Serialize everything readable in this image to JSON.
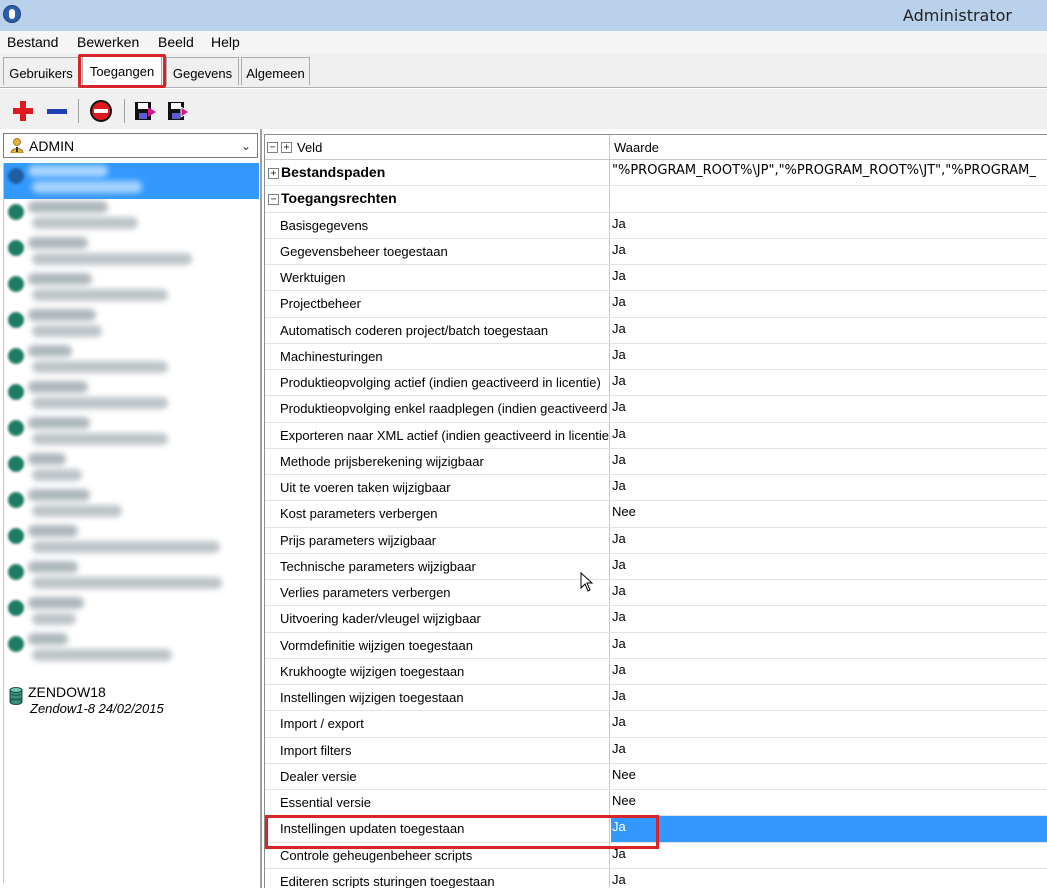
{
  "window": {
    "title": "Administrator"
  },
  "menu": [
    {
      "label": "Bestand"
    },
    {
      "label": "Bewerken"
    },
    {
      "label": "Beeld"
    },
    {
      "label": "Help"
    }
  ],
  "tabs": [
    {
      "label": "Gebruikers",
      "active": false
    },
    {
      "label": "Toegangen",
      "active": true
    },
    {
      "label": "Gegevens",
      "active": false
    },
    {
      "label": "Algemeen",
      "active": false
    }
  ],
  "toolbar": {
    "buttons": [
      "add-icon",
      "remove-icon",
      "delete-icon",
      "save-icon",
      "save-as-icon"
    ]
  },
  "user_select": {
    "value": "ADMIN"
  },
  "databases": {
    "visible_item": {
      "name": "ZENDOW18",
      "subtitle": "Zendow1-8 24/02/2015"
    }
  },
  "grid": {
    "header": {
      "field": "Veld",
      "value": "Waarde"
    },
    "groups": [
      {
        "label": "Bestandspaden",
        "expanded": false,
        "value": "\"%PROGRAM_ROOT%\\JP\",\"%PROGRAM_ROOT%\\JT\",\"%PROGRAM_"
      },
      {
        "label": "Toegangsrechten",
        "expanded": true,
        "value": ""
      }
    ],
    "rows": [
      {
        "label": "Basisgegevens",
        "value": "Ja"
      },
      {
        "label": "Gegevensbeheer toegestaan",
        "value": "Ja"
      },
      {
        "label": "Werktuigen",
        "value": "Ja"
      },
      {
        "label": "Projectbeheer",
        "value": "Ja"
      },
      {
        "label": "Automatisch coderen project/batch toegestaan",
        "value": "Ja"
      },
      {
        "label": "Machinesturingen",
        "value": "Ja"
      },
      {
        "label": "Produktieopvolging actief (indien geactiveerd in licentie)",
        "value": "Ja"
      },
      {
        "label": "Produktieopvolging enkel raadplegen (indien geactiveerd",
        "value": "Ja"
      },
      {
        "label": "Exporteren naar XML actief (indien geactiveerd in licentie",
        "value": "Ja"
      },
      {
        "label": "Methode prijsberekening wijzigbaar",
        "value": "Ja"
      },
      {
        "label": "Uit te voeren taken wijzigbaar",
        "value": "Ja"
      },
      {
        "label": "Kost parameters verbergen",
        "value": "Nee"
      },
      {
        "label": "Prijs parameters wijzigbaar",
        "value": "Ja"
      },
      {
        "label": "Technische parameters wijzigbaar",
        "value": "Ja"
      },
      {
        "label": "Verlies parameters verbergen",
        "value": "Ja"
      },
      {
        "label": "Uitvoering kader/vleugel wijzigbaar",
        "value": "Ja"
      },
      {
        "label": "Vormdefinitie wijzigen toegestaan",
        "value": "Ja"
      },
      {
        "label": "Krukhoogte wijzigen toegestaan",
        "value": "Ja"
      },
      {
        "label": "Instellingen wijzigen toegestaan",
        "value": "Ja"
      },
      {
        "label": "Import / export",
        "value": "Ja"
      },
      {
        "label": "Import filters",
        "value": "Ja"
      },
      {
        "label": "Dealer versie",
        "value": "Nee"
      },
      {
        "label": "Essential versie",
        "value": "Nee"
      },
      {
        "label": "Instellingen updaten toegestaan",
        "value": "Ja",
        "selected": true
      },
      {
        "label": "Controle geheugenbeheer scripts",
        "value": "Ja"
      },
      {
        "label": "Editeren scripts sturingen toegestaan",
        "value": "Ja"
      }
    ]
  },
  "colors": {
    "selection": "#3399ff",
    "highlight_box": "#d7252b",
    "titlebar": "#b9d1ea"
  }
}
